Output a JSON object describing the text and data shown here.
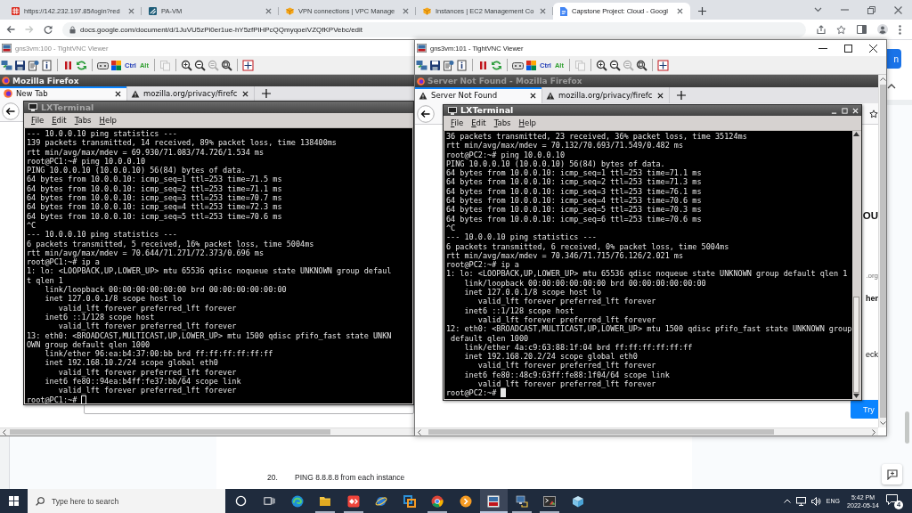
{
  "browser": {
    "tabs": [
      {
        "kind": "grid",
        "title": "https://142.232.197.85/login?red",
        "selected": false
      },
      {
        "kind": "tile",
        "title": "PA-VM",
        "selected": false
      },
      {
        "kind": "cube",
        "title": "VPN connections | VPC Manage",
        "selected": false
      },
      {
        "kind": "cube",
        "title": "Instances | EC2 Management Co",
        "selected": false
      },
      {
        "kind": "doc",
        "title": "Capstone Project: Cloud - Googl",
        "selected": true
      }
    ],
    "nav_buttons": [
      {
        "kind": "back",
        "disabled": false
      },
      {
        "kind": "forward",
        "disabled": true
      },
      {
        "kind": "reload",
        "disabled": false
      }
    ],
    "url": "docs.google.com/document/d/1JuVU5zPi0er1ue-hY5zfPlHPcQQmyqoeiVZQfKPVebc/edit"
  },
  "docs": {
    "button_label": "n",
    "list_items": [
      {
        "number": "20.",
        "text": "PING 8.8.8.8 from each instance"
      }
    ]
  },
  "vnc_windows": [
    {
      "title": "gns3vm:100 - TightVNC Viewer",
      "active": false,
      "toolbar": [
        {
          "kind": "connection",
          "disabled": false
        },
        {
          "kind": "save",
          "disabled": false
        },
        {
          "kind": "options",
          "disabled": false
        },
        {
          "kind": "info",
          "disabled": false
        },
        {
          "kind": "pause",
          "disabled": false
        },
        {
          "kind": "refresh",
          "disabled": false
        },
        {
          "kind": "keys",
          "disabled": false
        },
        {
          "kind": "blocks",
          "disabled": false
        },
        {
          "kind": "ctrl",
          "label": "Ctrl",
          "disabled": false
        },
        {
          "kind": "alt",
          "label": "Alt",
          "disabled": false
        },
        {
          "kind": "clipboard",
          "disabled": true
        },
        {
          "kind": "zoom-in",
          "disabled": false
        },
        {
          "kind": "zoom-out",
          "disabled": false
        },
        {
          "kind": "zoom-reset",
          "disabled": true
        },
        {
          "kind": "zoom-fit",
          "disabled": false
        },
        {
          "kind": "fullscreen",
          "disabled": false
        }
      ],
      "firefox": {
        "title": "Mozilla Firefox",
        "active": true,
        "tabs": [
          {
            "kind": "browser",
            "title": "New Tab",
            "selected": true
          },
          {
            "kind": "warning",
            "title": "mozilla.org/privacy/firefc",
            "selected": false
          }
        ],
        "page": {
          "kind": "new-tab"
        }
      },
      "terminal": {
        "title": "LXTerminal",
        "active": false,
        "menu": [
          "File",
          "Edit",
          "Tabs",
          "Help"
        ],
        "lines": [
          "--- 10.0.0.10 ping statistics ---",
          "139 packets transmitted, 14 received, 89% packet loss, time 138400ms",
          "rtt min/avg/max/mdev = 69.930/71.083/74.726/1.534 ms",
          "root@PC1:~# ping 10.0.0.10",
          "PING 10.0.0.10 (10.0.0.10) 56(84) bytes of data.",
          "64 bytes from 10.0.0.10: icmp_seq=1 ttl=253 time=71.5 ms",
          "64 bytes from 10.0.0.10: icmp_seq=2 ttl=253 time=71.1 ms",
          "64 bytes from 10.0.0.10: icmp_seq=3 ttl=253 time=70.7 ms",
          "64 bytes from 10.0.0.10: icmp_seq=4 ttl=253 time=72.3 ms",
          "64 bytes from 10.0.0.10: icmp_seq=5 ttl=253 time=70.6 ms",
          "^C",
          "--- 10.0.0.10 ping statistics ---",
          "6 packets transmitted, 5 received, 16% packet loss, time 5004ms",
          "rtt min/avg/max/mdev = 70.644/71.271/72.373/0.696 ms",
          "root@PC1:~# ip a",
          "1: lo: <LOOPBACK,UP,LOWER_UP> mtu 65536 qdisc noqueue state UNKNOWN group defaul",
          "t qlen 1",
          "    link/loopback 00:00:00:00:00:00 brd 00:00:00:00:00:00",
          "    inet 127.0.0.1/8 scope host lo",
          "       valid_lft forever preferred_lft forever",
          "    inet6 ::1/128 scope host",
          "       valid_lft forever preferred_lft forever",
          "13: eth0: <BROADCAST,MULTICAST,UP,LOWER_UP> mtu 1500 qdisc pfifo_fast state UNKN",
          "OWN group default qlen 1000",
          "    link/ether 96:ea:b4:37:00:bb brd ff:ff:ff:ff:ff:ff",
          "    inet 192.168.10.2/24 scope global eth0",
          "       valid_lft forever preferred_lft forever",
          "    inet6 fe80::94ea:b4ff:fe37:bb/64 scope link",
          "       valid_lft forever preferred_lft forever"
        ],
        "prompt": "root@PC1:~#"
      }
    },
    {
      "title": "gns3vm:101 - TightVNC Viewer",
      "active": true,
      "toolbar": [
        {
          "kind": "connection",
          "disabled": false
        },
        {
          "kind": "save",
          "disabled": false
        },
        {
          "kind": "options",
          "disabled": false
        },
        {
          "kind": "info",
          "disabled": false
        },
        {
          "kind": "pause",
          "disabled": false
        },
        {
          "kind": "refresh",
          "disabled": false
        },
        {
          "kind": "keys",
          "disabled": false
        },
        {
          "kind": "blocks",
          "disabled": false
        },
        {
          "kind": "ctrl",
          "label": "Ctrl",
          "disabled": false
        },
        {
          "kind": "alt",
          "label": "Alt",
          "disabled": false
        },
        {
          "kind": "clipboard",
          "disabled": true
        },
        {
          "kind": "zoom-in",
          "disabled": false
        },
        {
          "kind": "zoom-out",
          "disabled": false
        },
        {
          "kind": "zoom-reset",
          "disabled": true
        },
        {
          "kind": "zoom-fit",
          "disabled": false
        },
        {
          "kind": "fullscreen",
          "disabled": false
        }
      ],
      "firefox": {
        "title": "Server Not Found - Mozilla Firefox",
        "active": false,
        "tabs": [
          {
            "kind": "warning",
            "title": "Server Not Found",
            "selected": true
          },
          {
            "kind": "warning",
            "title": "mozilla.org/privacy/firefc",
            "selected": false
          }
        ],
        "page": {
          "kind": "error",
          "fragments": [
            "OU",
            ".org",
            "her",
            "eck"
          ],
          "button": "Try"
        }
      },
      "terminal": {
        "title": "LXTerminal",
        "active": true,
        "menu": [
          "File",
          "Edit",
          "Tabs",
          "Help"
        ],
        "lines": [
          "36 packets transmitted, 23 received, 36% packet loss, time 35124ms",
          "rtt min/avg/max/mdev = 70.132/70.693/71.549/0.482 ms",
          "root@PC2:~# ping 10.0.0.10",
          "PING 10.0.0.10 (10.0.0.10) 56(84) bytes of data.",
          "64 bytes from 10.0.0.10: icmp_seq=1 ttl=253 time=71.1 ms",
          "64 bytes from 10.0.0.10: icmp_seq=2 ttl=253 time=71.3 ms",
          "64 bytes from 10.0.0.10: icmp_seq=3 ttl=253 time=76.1 ms",
          "64 bytes from 10.0.0.10: icmp_seq=4 ttl=253 time=70.6 ms",
          "64 bytes from 10.0.0.10: icmp_seq=5 ttl=253 time=70.3 ms",
          "64 bytes from 10.0.0.10: icmp_seq=6 ttl=253 time=70.6 ms",
          "^C",
          "--- 10.0.0.10 ping statistics ---",
          "6 packets transmitted, 6 received, 0% packet loss, time 5004ms",
          "rtt min/avg/max/mdev = 70.346/71.715/76.126/2.021 ms",
          "root@PC2:~# ip a",
          "1: lo: <LOOPBACK,UP,LOWER_UP> mtu 65536 qdisc noqueue state UNKNOWN group default qlen 1",
          "    link/loopback 00:00:00:00:00:00 brd 00:00:00:00:00:00",
          "    inet 127.0.0.1/8 scope host lo",
          "       valid_lft forever preferred_lft forever",
          "    inet6 ::1/128 scope host",
          "       valid_lft forever preferred_lft forever",
          "12: eth0: <BROADCAST,MULTICAST,UP,LOWER_UP> mtu 1500 qdisc pfifo_fast state UNKNOWN group",
          " default qlen 1000",
          "    link/ether 4a:c9:63:88:1f:04 brd ff:ff:ff:ff:ff:ff",
          "    inet 192.168.20.2/24 scope global eth0",
          "       valid_lft forever preferred_lft forever",
          "    inet6 fe80::48c9:63ff:fe88:1f04/64 scope link",
          "       valid_lft forever preferred_lft forever"
        ],
        "prompt": "root@PC2:~#"
      }
    }
  ],
  "taskbar": {
    "search_placeholder": "Type here to search",
    "apps": [
      {
        "kind": "circle",
        "selected": false,
        "running": false
      },
      {
        "kind": "taskview",
        "selected": false,
        "running": false
      },
      {
        "kind": "swirl",
        "selected": false,
        "running": false
      },
      {
        "kind": "folder",
        "selected": false,
        "running": true
      },
      {
        "kind": "diamond",
        "selected": false,
        "running": true
      },
      {
        "kind": "globe",
        "selected": false,
        "running": false
      },
      {
        "kind": "squares",
        "selected": false,
        "running": false
      },
      {
        "kind": "round",
        "selected": false,
        "running": true
      },
      {
        "kind": "chevron",
        "selected": false,
        "running": false
      },
      {
        "kind": "viewer",
        "selected": true,
        "running": true
      },
      {
        "kind": "computer",
        "selected": false,
        "running": true
      },
      {
        "kind": "console",
        "selected": false,
        "running": true
      },
      {
        "kind": "box",
        "selected": false,
        "running": false
      }
    ],
    "language": "ENG",
    "time": "5:42 PM",
    "date": "2022-05-14",
    "notification_count": "4"
  }
}
